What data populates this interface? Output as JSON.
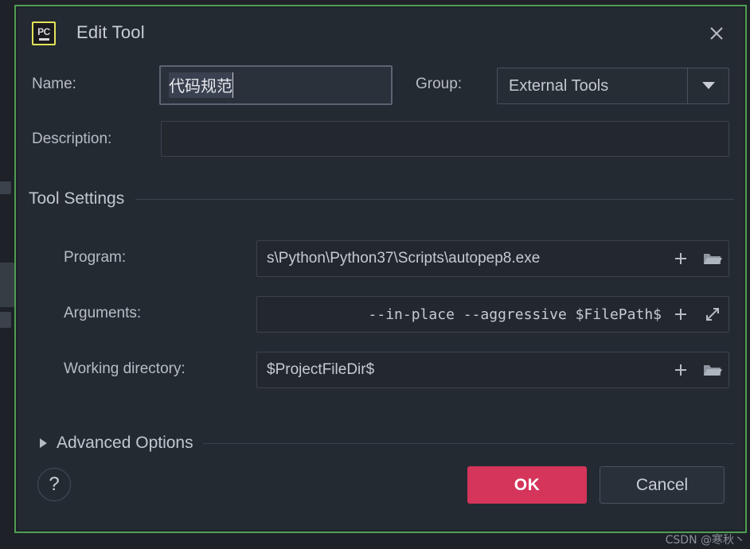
{
  "window": {
    "title": "Edit Tool",
    "app_icon": "pycharm-icon",
    "app_icon_text": "PC",
    "close_icon": "close-icon",
    "accent_color": "#d5355b",
    "frame_color": "#4f9e52",
    "background_color": "#242a32"
  },
  "form": {
    "name_label": "Name:",
    "name_value": "代码规范",
    "group_label": "Group:",
    "group_value": "External Tools",
    "group_arrow_icon": "chevron-down-icon",
    "description_label": "Description:",
    "description_value": ""
  },
  "tool_settings": {
    "section_label": "Tool Settings",
    "fields": [
      {
        "label": "Program:",
        "value": "s\\Python\\Python37\\Scripts\\autopep8.exe",
        "mono": false,
        "actions": [
          "plus-icon",
          "folder-icon"
        ]
      },
      {
        "label": "Arguments:",
        "value": "--in-place --aggressive $FilePath$",
        "mono": true,
        "actions": [
          "plus-icon",
          "expand-diagonal-icon"
        ]
      },
      {
        "label": "Working directory:",
        "value": "$ProjectFileDir$",
        "mono": false,
        "actions": [
          "plus-icon",
          "folder-icon"
        ]
      }
    ]
  },
  "advanced": {
    "label": "Advanced Options",
    "expanded": false,
    "triangle_icon": "triangle-right-icon"
  },
  "footer": {
    "help_label": "?",
    "ok_label": "OK",
    "cancel_label": "Cancel"
  },
  "watermark": {
    "text": "CSDN @寒秋丶"
  }
}
